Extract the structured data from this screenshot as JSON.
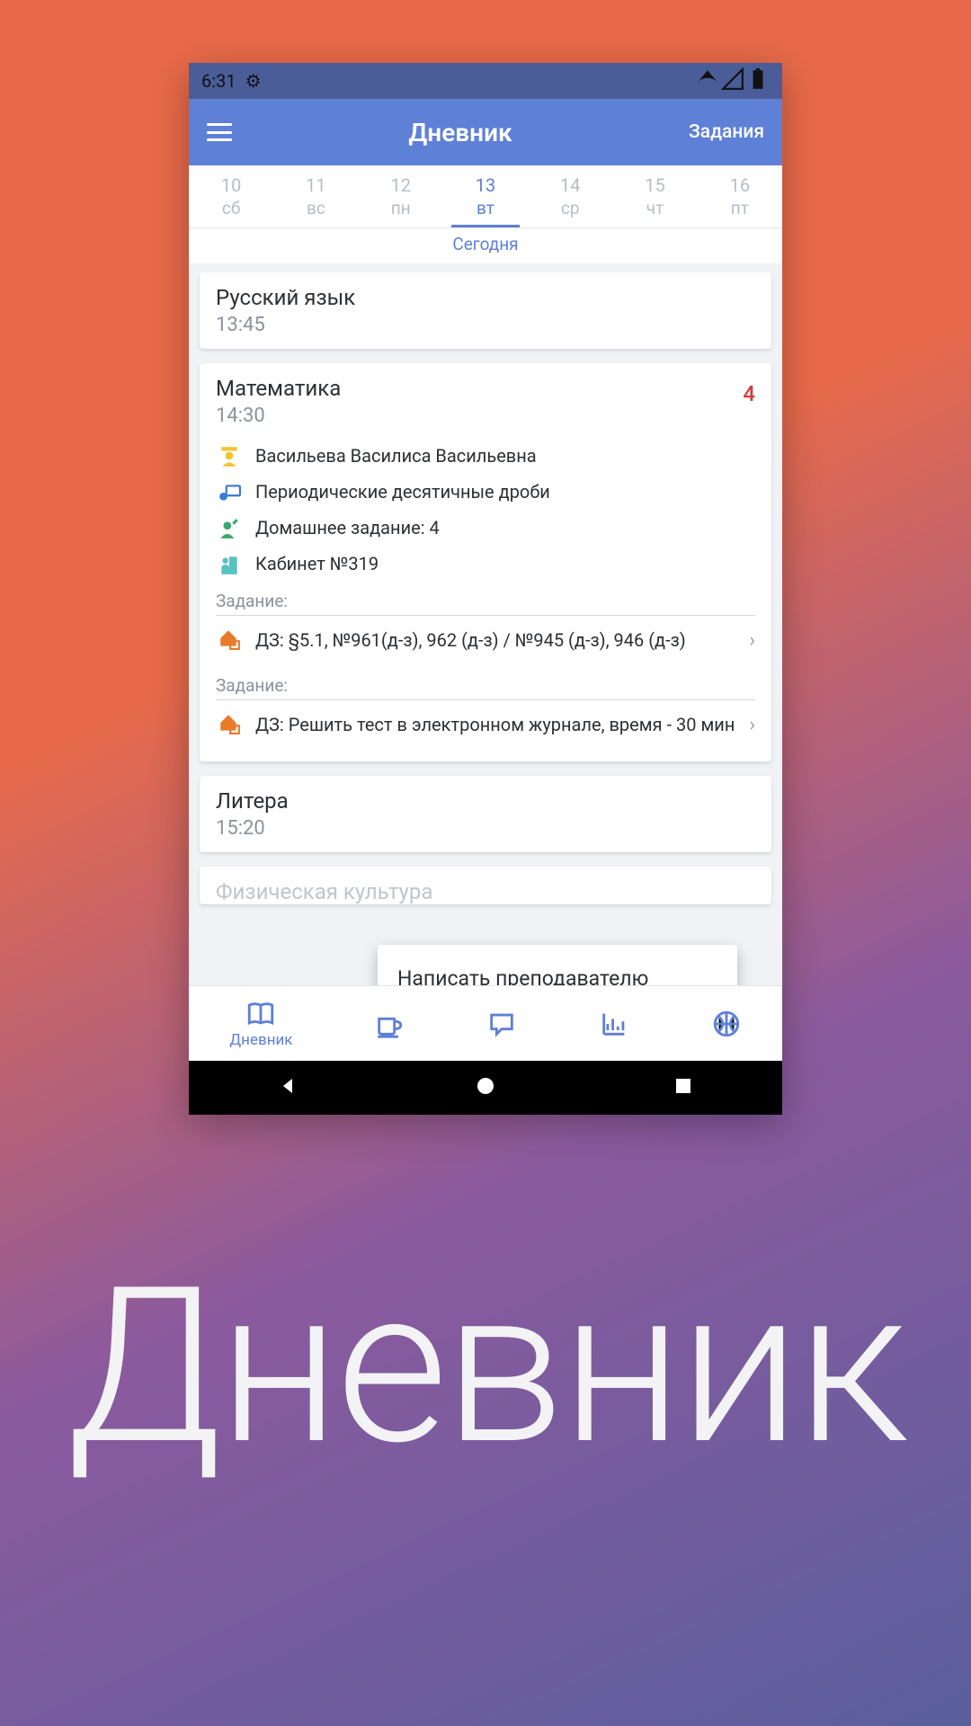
{
  "statusbar": {
    "time": "6:31"
  },
  "appbar": {
    "title": "Дневник",
    "action": "Задания"
  },
  "today_label": "Сегодня",
  "dates": [
    {
      "num": "10",
      "dow": "сб",
      "selected": false
    },
    {
      "num": "11",
      "dow": "вс",
      "selected": false
    },
    {
      "num": "12",
      "dow": "пн",
      "selected": false
    },
    {
      "num": "13",
      "dow": "вт",
      "selected": true
    },
    {
      "num": "14",
      "dow": "ср",
      "selected": false
    },
    {
      "num": "15",
      "dow": "чт",
      "selected": false
    },
    {
      "num": "16",
      "dow": "пт",
      "selected": false
    }
  ],
  "lessons": {
    "russian": {
      "subject": "Русский язык",
      "time": "13:45"
    },
    "math": {
      "subject": "Математика",
      "time": "14:30",
      "grade": "4",
      "teacher": "Васильева Василиса Васильевна",
      "topic": "Периодические десятичные дроби",
      "homework_count": "Домашнее задание: 4",
      "room": "Кабинет №319",
      "section_label": "Задание:",
      "task1": "ДЗ:  §5.1,  №961(д-з), 962 (д-з) /  №945 (д-з), 946 (д-з)",
      "task2": "ДЗ: Решить тест в электронном журнале, время - 30 мин"
    },
    "lit": {
      "subject": "Литера",
      "time": "15:20"
    },
    "pe": {
      "subject": "Физическая культура"
    }
  },
  "popup": {
    "text": "Написать преподавателю"
  },
  "bottomnav": {
    "diary": "Дневник"
  },
  "big_title": "Дневник"
}
